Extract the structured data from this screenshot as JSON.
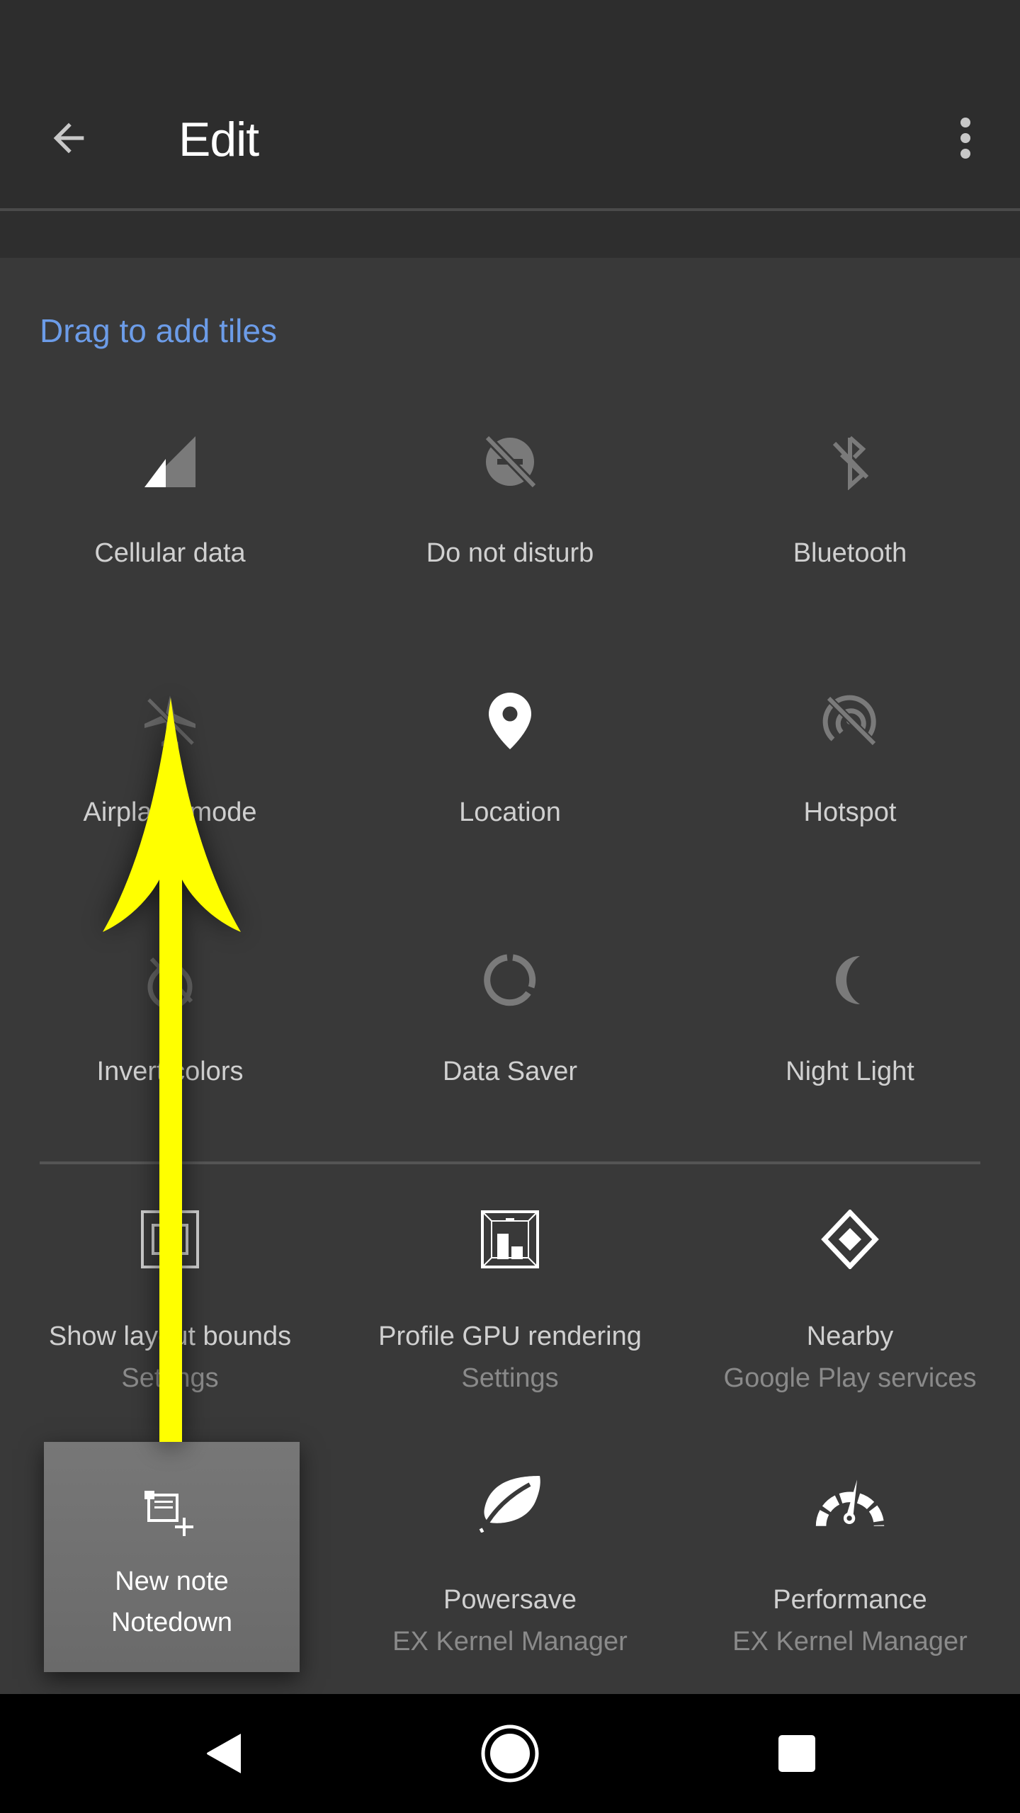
{
  "header": {
    "title": "Edit",
    "back_icon": "arrow-back-icon",
    "more_icon": "more-vert-icon"
  },
  "section": {
    "title": "Drag to add tiles",
    "accent_color": "#6c9ce8"
  },
  "tiles": [
    {
      "label": "Cellular data",
      "icon": "cellular-signal-icon"
    },
    {
      "label": "Do not disturb",
      "icon": "do-not-disturb-off-icon"
    },
    {
      "label": "Bluetooth",
      "icon": "bluetooth-disabled-icon"
    },
    {
      "label": "Airplane mode",
      "icon": "airplane-off-icon"
    },
    {
      "label": "Location",
      "icon": "location-pin-icon"
    },
    {
      "label": "Hotspot",
      "icon": "hotspot-off-icon"
    },
    {
      "label": "Invert colors",
      "icon": "invert-colors-off-icon"
    },
    {
      "label": "Data Saver",
      "icon": "data-saver-icon"
    },
    {
      "label": "Night Light",
      "icon": "night-light-moon-icon"
    }
  ],
  "app_tiles": [
    {
      "label": "Show layout bounds",
      "sub": "Settings",
      "icon": "layout-bounds-icon"
    },
    {
      "label": "Profile GPU rendering",
      "sub": "Settings",
      "icon": "gpu-profile-icon"
    },
    {
      "label": "Nearby",
      "sub": "Google Play services",
      "icon": "nearby-diamond-icon"
    },
    {
      "label": "New note",
      "sub": "Notedown",
      "icon": "new-note-icon"
    },
    {
      "label": "Powersave",
      "sub": "EX Kernel Manager",
      "icon": "leaf-icon"
    },
    {
      "label": "Performance",
      "sub": "EX Kernel Manager",
      "icon": "speedometer-icon"
    }
  ],
  "annotation": {
    "type": "arrow-up",
    "color": "#ffff00"
  },
  "navbar": {
    "back": "nav-back-icon",
    "home": "nav-home-icon",
    "recents": "nav-recents-icon"
  }
}
